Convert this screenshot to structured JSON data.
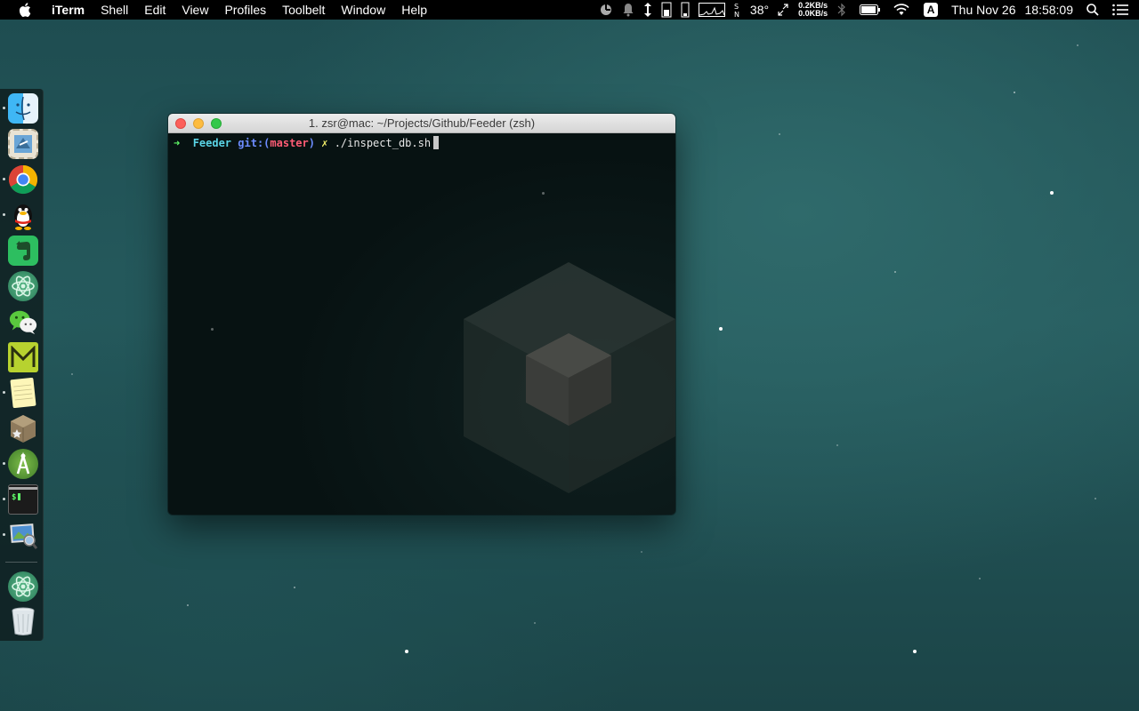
{
  "menubar": {
    "apple_icon": "apple-logo",
    "app_name": "iTerm",
    "menus": [
      "Shell",
      "Edit",
      "View",
      "Profiles",
      "Toolbelt",
      "Window",
      "Help"
    ],
    "status": {
      "temperature": "38°",
      "net_up": "0.2KB/s",
      "net_down": "0.0KB/s",
      "input_source": "A",
      "date": "Thu Nov 26",
      "time": "18:58:09",
      "icons": [
        "cpu-monitor-icon",
        "notification-bell-icon",
        "arrows-icon",
        "memory-icon",
        "disk-icon",
        "cpu-graph-icon",
        "sensor-icon",
        "expand-icon",
        "bluetooth-icon",
        "battery-icon",
        "wifi-icon",
        "spotlight-search-icon",
        "notification-center-icon"
      ]
    }
  },
  "dock": {
    "apps": [
      {
        "name": "finder-icon",
        "running": true
      },
      {
        "name": "mail-stamp-icon",
        "running": false
      },
      {
        "name": "chrome-icon",
        "running": true
      },
      {
        "name": "qq-penguin-icon",
        "running": true
      },
      {
        "name": "evernote-icon",
        "running": false
      },
      {
        "name": "atom-icon",
        "running": false
      },
      {
        "name": "wechat-icon",
        "running": false
      },
      {
        "name": "mindnode-icon",
        "running": false
      },
      {
        "name": "notes-icon",
        "running": true
      },
      {
        "name": "package-icon",
        "running": false
      },
      {
        "name": "android-studio-icon",
        "running": true
      },
      {
        "name": "terminal-icon",
        "running": true
      },
      {
        "name": "preview-icon",
        "running": true
      },
      {
        "name": "atom-icon",
        "running": false
      },
      {
        "name": "trash-icon",
        "running": false
      }
    ]
  },
  "terminal": {
    "title": "1. zsr@mac: ~/Projects/Github/Feeder (zsh)",
    "prompt": {
      "arrow": "➜",
      "dir": "Feeder",
      "git_prefix": "git:(",
      "branch": "master",
      "git_suffix": ")",
      "dirty_mark": "✗",
      "command": "./inspect_db.sh"
    }
  }
}
